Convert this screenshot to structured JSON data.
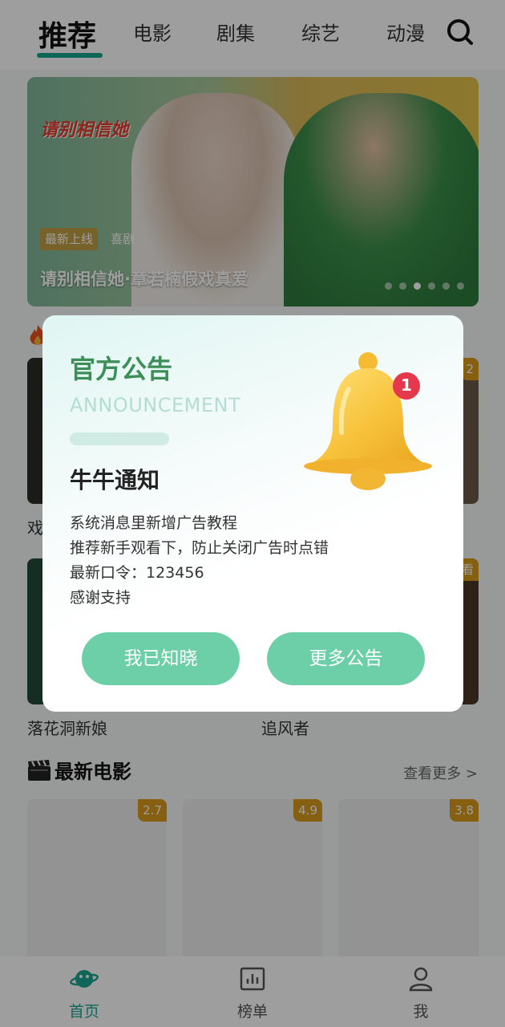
{
  "topnav": {
    "tabs": [
      {
        "label": "推荐",
        "active": true
      },
      {
        "label": "电影"
      },
      {
        "label": "剧集"
      },
      {
        "label": "综艺"
      },
      {
        "label": "动漫"
      }
    ],
    "search_icon": "search-icon"
  },
  "banner": {
    "logo_text": "请别相信她",
    "tag": "最新上线",
    "tag2": "喜剧",
    "title": "请别相信她·章若楠假戏真爱",
    "dots": 6,
    "active_dot": 2
  },
  "rows": {
    "row1_left_label": "戏",
    "row1_right_badge": "2",
    "row2_left_label": "落花洞新娘",
    "row2_right_label": "追风者",
    "row2_right_badge": "看"
  },
  "latest_movies": {
    "title": "最新电影",
    "see_more": "查看更多 >",
    "items": [
      {
        "score": "2.7"
      },
      {
        "score": "4.9"
      },
      {
        "score": "3.8"
      }
    ]
  },
  "bottomnav": {
    "items": [
      {
        "label": "首页",
        "icon": "planet-icon",
        "active": true
      },
      {
        "label": "榜单",
        "icon": "chart-icon"
      },
      {
        "label": "我",
        "icon": "user-icon"
      }
    ]
  },
  "modal": {
    "title": "官方公告",
    "subtitle": "ANNOUNCEMENT",
    "heading": "牛牛通知",
    "lines": [
      "系统消息里新增广告教程",
      "推荐新手观看下，防止关闭广告时点错",
      "最新口令：123456",
      "感谢支持"
    ],
    "bell_badge": "1",
    "ack_button": "我已知晓",
    "more_button": "更多公告"
  },
  "colors": {
    "accent": "#18a58d",
    "button": "#6ccfa8",
    "title_green": "#3e8e58",
    "badge": "#d89a1c"
  }
}
